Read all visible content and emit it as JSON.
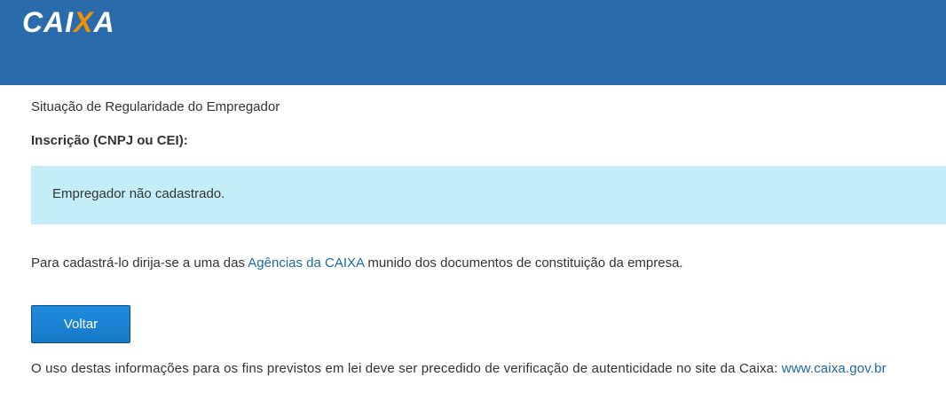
{
  "header": {
    "logo_prefix": "CAI",
    "logo_x": "X",
    "logo_suffix": "A"
  },
  "main": {
    "title": "Situação de Regularidade do Empregador",
    "inscricao_label": "Inscrição (CNPJ ou CEI):",
    "alert_message": "Empregador não cadastrado.",
    "info_before": "Para cadastrá-lo dirija-se a uma das ",
    "info_link": "Agências da CAIXA",
    "info_after": " munido dos documentos de constituição da empresa.",
    "back_button": "Voltar",
    "footer_text": "O uso destas informações para os fins previstos em lei deve ser precedido de verificação de autenticidade no site da Caixa: ",
    "footer_link": "www.caixa.gov.br"
  },
  "colors": {
    "header_bg": "#2a6cab",
    "alert_bg": "#c4eef7",
    "link": "#1b6aa6",
    "button": "#1679c6",
    "logo_accent": "#f39200"
  }
}
